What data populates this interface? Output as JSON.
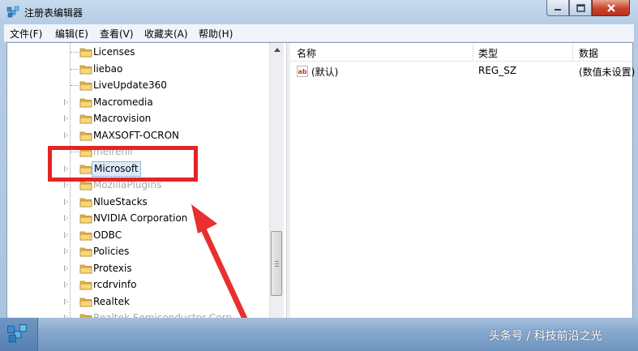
{
  "window": {
    "title": "注册表编辑器"
  },
  "menu": [
    {
      "label": "文件(F)"
    },
    {
      "label": "编辑(E)"
    },
    {
      "label": "查看(V)"
    },
    {
      "label": "收藏夹(A)"
    },
    {
      "label": "帮助(H)"
    }
  ],
  "tree": {
    "items": [
      {
        "label": "Licenses",
        "expandable": false
      },
      {
        "label": "liebao",
        "expandable": false
      },
      {
        "label": "LiveUpdate360",
        "expandable": false
      },
      {
        "label": "Macromedia",
        "expandable": true
      },
      {
        "label": "Macrovision",
        "expandable": true
      },
      {
        "label": "MAXSOFT-OCRON",
        "expandable": true
      },
      {
        "label": "meirenli",
        "expandable": false
      },
      {
        "label": "Microsoft",
        "expandable": true,
        "selected": true
      },
      {
        "label": "MozillaPlugins",
        "expandable": true
      },
      {
        "label": "NlueStacks",
        "expandable": true
      },
      {
        "label": "NVIDIA Corporation",
        "expandable": true
      },
      {
        "label": "ODBC",
        "expandable": true
      },
      {
        "label": "Policies",
        "expandable": true
      },
      {
        "label": "Protexis",
        "expandable": true
      },
      {
        "label": "rcdrvinfo",
        "expandable": true
      },
      {
        "label": "Realtek",
        "expandable": true
      },
      {
        "label": "Realtek Semiconductor Corp.",
        "expandable": true
      }
    ]
  },
  "values_pane": {
    "columns": [
      {
        "label": "名称"
      },
      {
        "label": "类型"
      },
      {
        "label": "数据"
      }
    ],
    "rows": [
      {
        "name": "(默认)",
        "type": "REG_SZ",
        "data": "(数值未设置)"
      }
    ]
  },
  "watermark": "头条号 / 科技前沿之光",
  "colors": {
    "highlight": "#e52424",
    "arrow": "#e8302f",
    "selection": "#dcebfc"
  }
}
